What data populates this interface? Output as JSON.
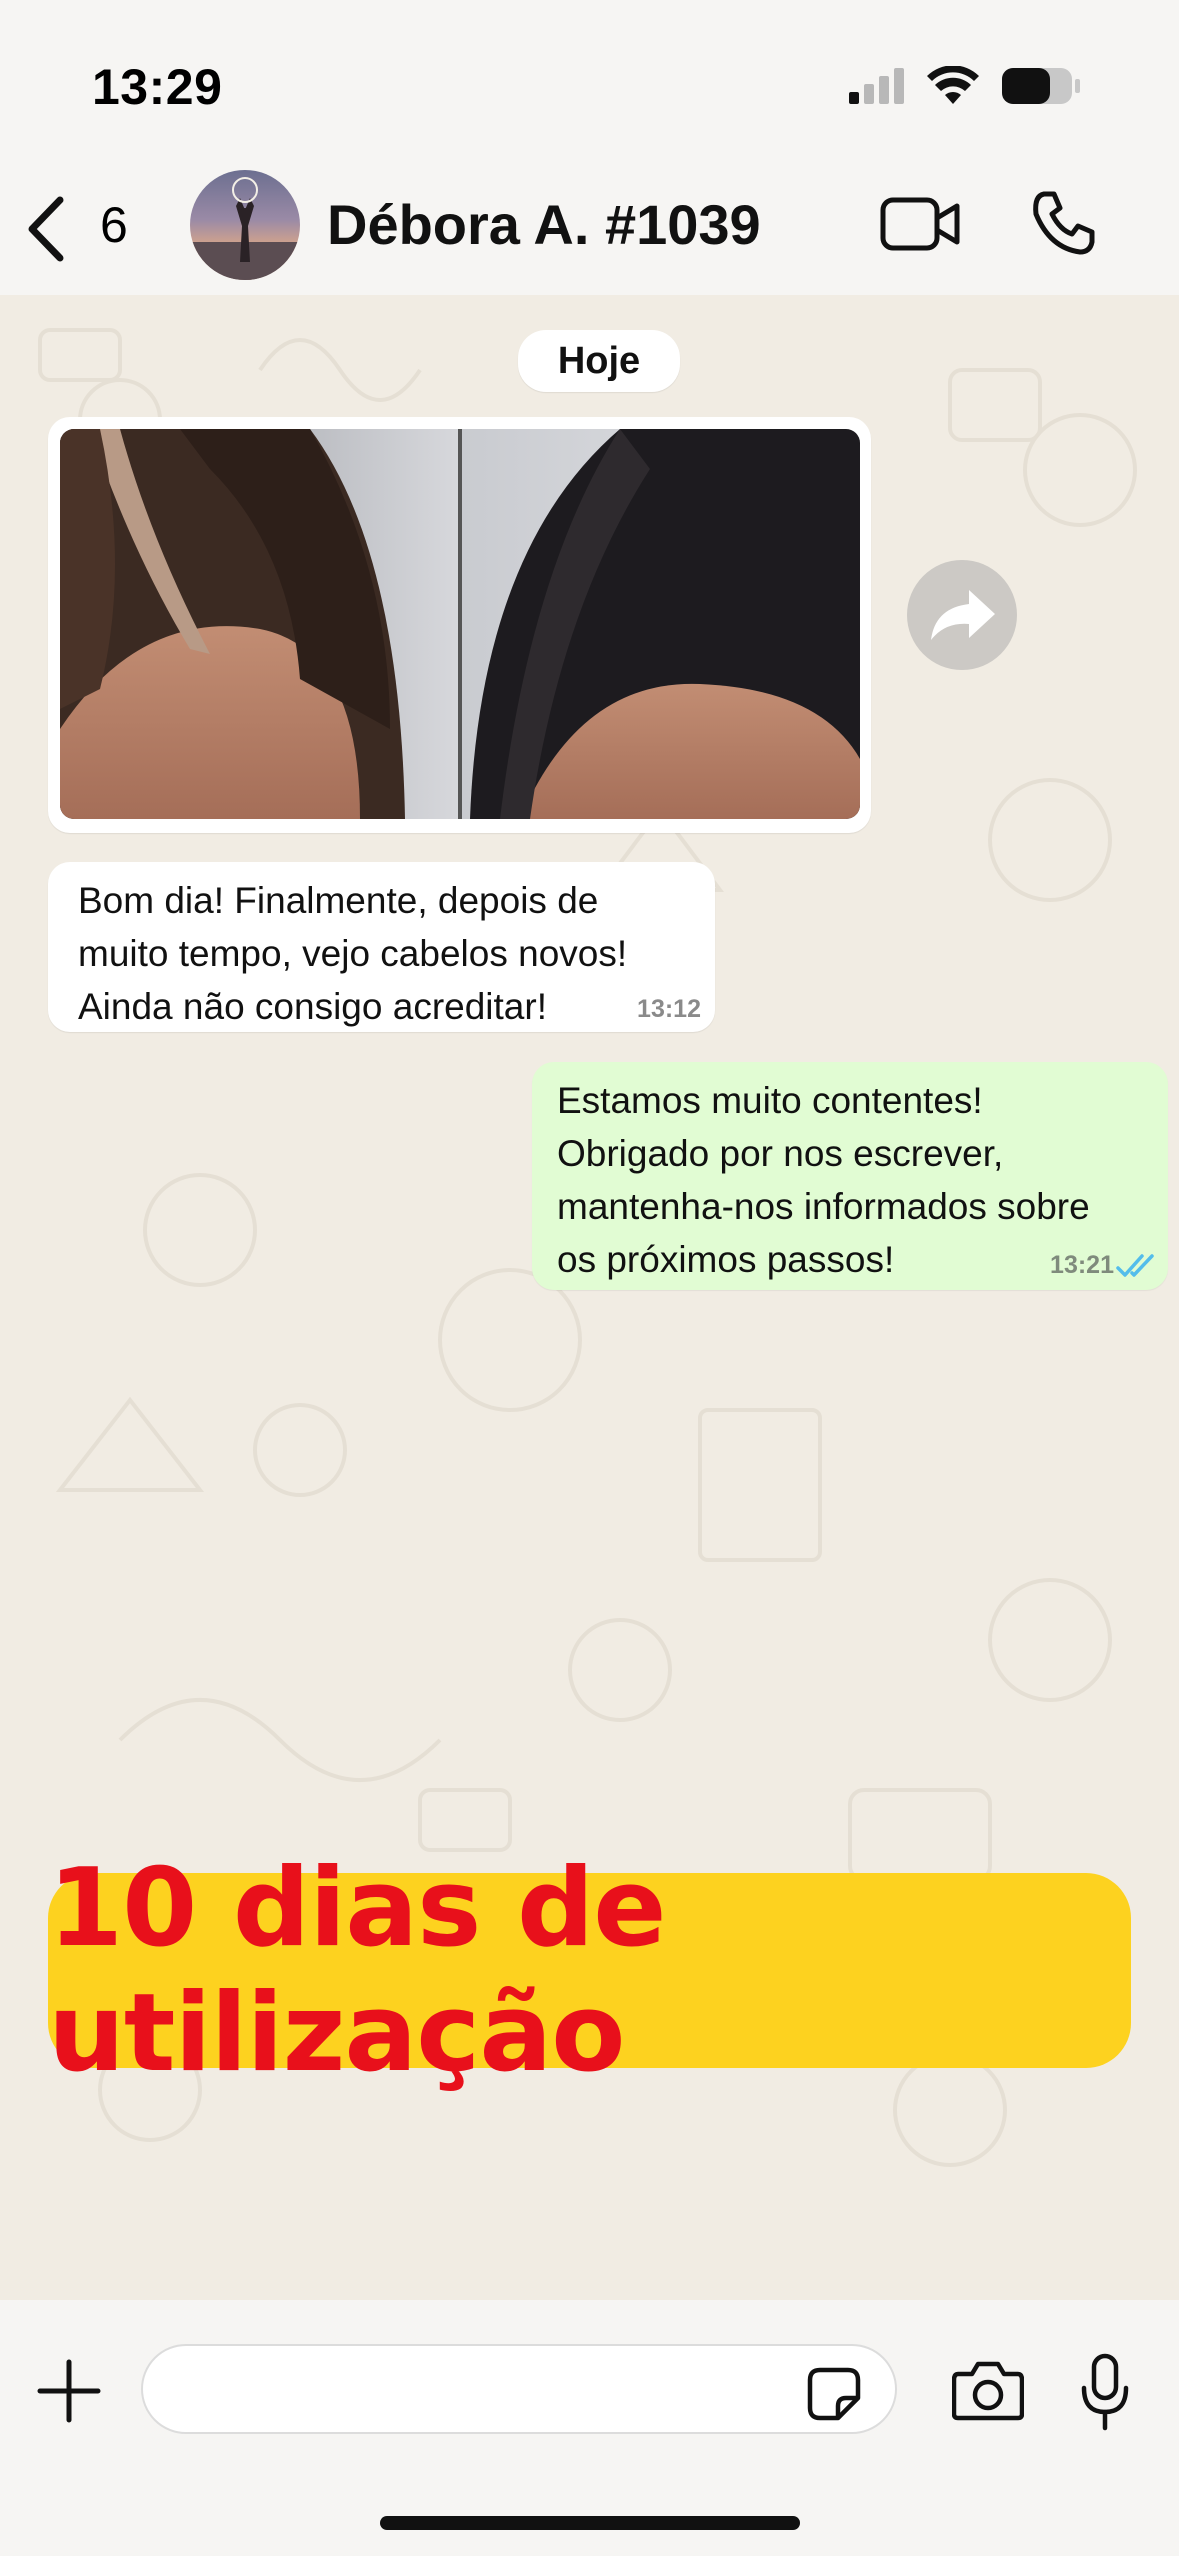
{
  "status_bar": {
    "time": "13:29"
  },
  "header": {
    "back_label": "",
    "unread_count": "6",
    "contact_name": "Débora A. #1039"
  },
  "chat": {
    "date_chip": "Hoje",
    "incoming_message": {
      "text": "Bom dia! Finalmente, depois de\nmuito tempo, vejo cabelos novos!\nAinda não consigo acreditar!",
      "time": "13:12"
    },
    "outgoing_message": {
      "text": "Estamos muito contentes!\nObrigado por nos escrever,\nmantenha-nos informados sobre\nos próximos passos!",
      "time": "13:21"
    }
  },
  "promo": {
    "text": "10 dias de utilização"
  },
  "composer": {
    "input_value": "",
    "input_placeholder": ""
  },
  "colors": {
    "outgoing_bubble": "#e1fcd3",
    "incoming_bubble": "#ffffff",
    "read_ticks": "#53bdeb",
    "promo_background": "#fdd21f",
    "promo_text": "#e8101b"
  }
}
